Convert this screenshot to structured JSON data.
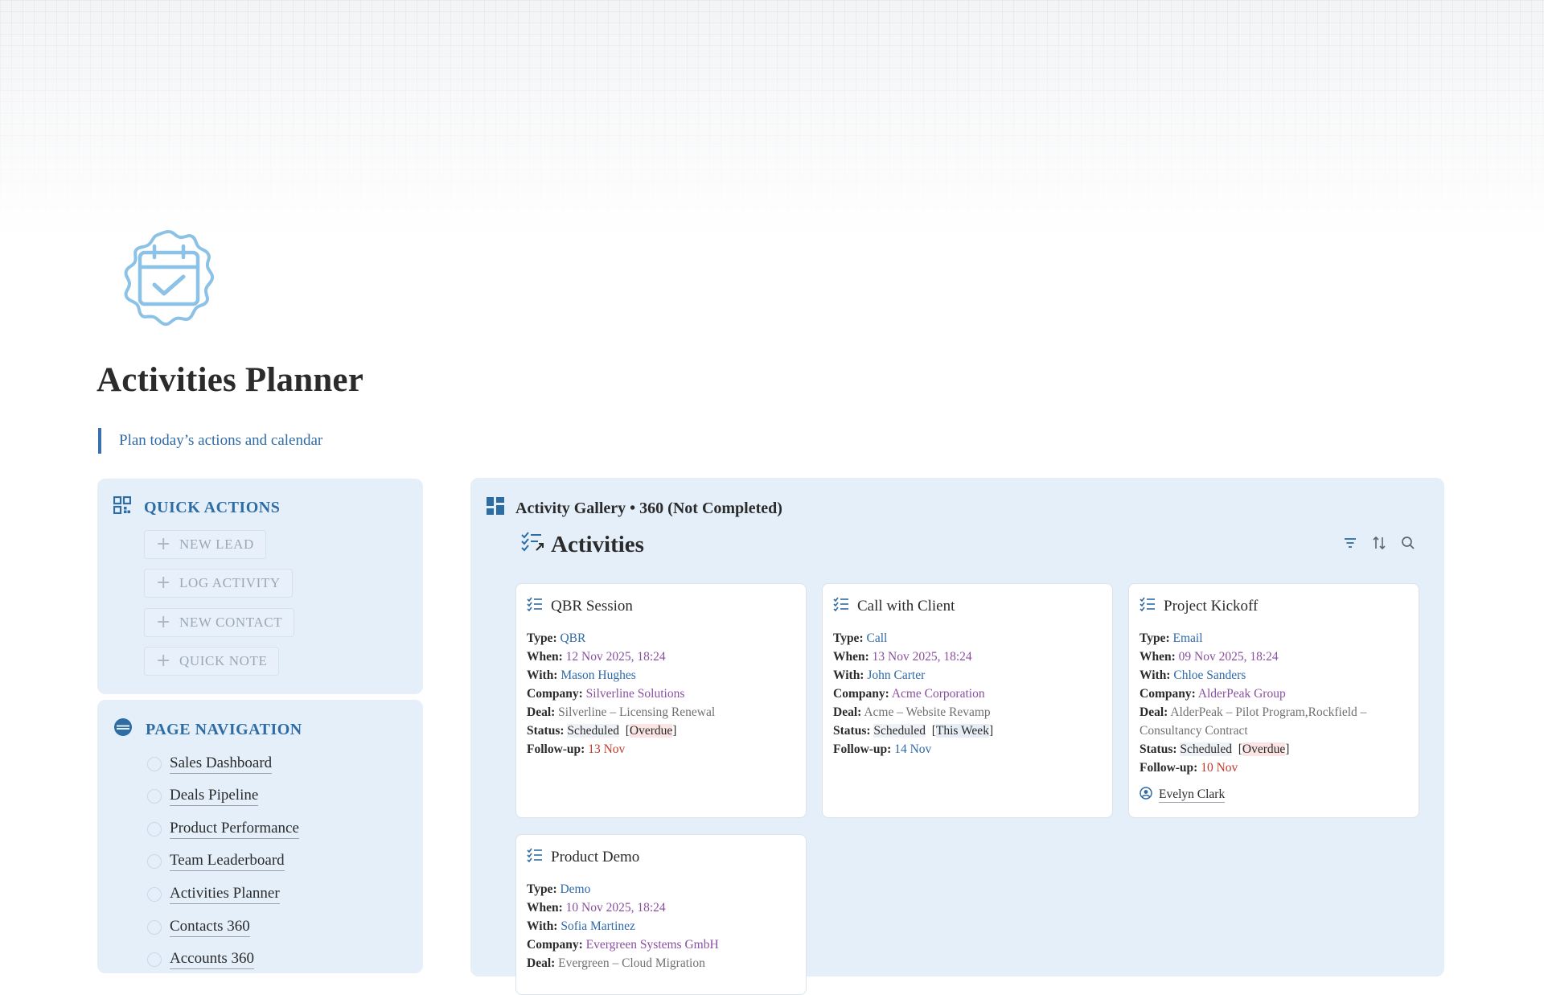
{
  "page": {
    "title": "Activities Planner",
    "subtitle": "Plan today’s actions and calendar",
    "icon": "calendar-check-icon"
  },
  "quick_actions": {
    "title": "QUICK ACTIONS",
    "buttons": [
      {
        "label": "NEW LEAD"
      },
      {
        "label": "LOG ACTIVITY"
      },
      {
        "label": "NEW CONTACT"
      },
      {
        "label": "QUICK NOTE"
      }
    ]
  },
  "page_navigation": {
    "title": "PAGE NAVIGATION",
    "items": [
      {
        "label": "Sales Dashboard"
      },
      {
        "label": "Deals Pipeline"
      },
      {
        "label": "Product Performance"
      },
      {
        "label": "Team Leaderboard"
      },
      {
        "label": "Activities Planner"
      },
      {
        "label": "Contacts 360"
      },
      {
        "label": "Accounts 360"
      }
    ]
  },
  "gallery": {
    "header": "Activity Gallery • 360 (Not Completed)",
    "database_title": "Activities",
    "field_labels": {
      "type": "Type:",
      "when": "When:",
      "with": "With:",
      "company": "Company:",
      "deal": "Deal:",
      "status": "Status:",
      "followup": "Follow-up:"
    },
    "cards": [
      {
        "title": "QBR Session",
        "type": "QBR",
        "when": "12 Nov 2025, 18:24",
        "with": "Mason Hughes",
        "company": "Silverline Solutions",
        "deal": "Silverline – Licensing Renewal",
        "status": "Scheduled",
        "status_tag": "Overdue",
        "followup": "13 Nov",
        "owner": ""
      },
      {
        "title": "Call with Client",
        "type": "Call",
        "when": "13 Nov 2025, 18:24",
        "with": "John Carter",
        "company": "Acme Corporation",
        "deal": "Acme – Website Revamp",
        "status": "Scheduled",
        "status_tag": "This Week",
        "followup": "14 Nov",
        "owner": ""
      },
      {
        "title": "Project Kickoff",
        "type": "Email",
        "when": "09 Nov 2025, 18:24",
        "with": "Chloe Sanders",
        "company": "AlderPeak Group",
        "deal": "AlderPeak – Pilot Program,Rockfield – Consultancy Contract",
        "status": "Scheduled",
        "status_tag": "Overdue",
        "followup": "10 Nov",
        "owner": "Evelyn Clark"
      },
      {
        "title": "Product Demo",
        "type": "Demo",
        "when": "10 Nov 2025, 18:24",
        "with": "Sofia Martinez",
        "company": "Evergreen Systems GmbH",
        "deal": "Evergreen – Cloud Migration",
        "status": "",
        "status_tag": "",
        "followup": "",
        "owner": ""
      }
    ]
  },
  "colors": {
    "accent": "#2e6ca4",
    "panel_bg": "#e4effa",
    "date_purple": "#8a4fa0",
    "overdue_red": "#c0392b"
  }
}
